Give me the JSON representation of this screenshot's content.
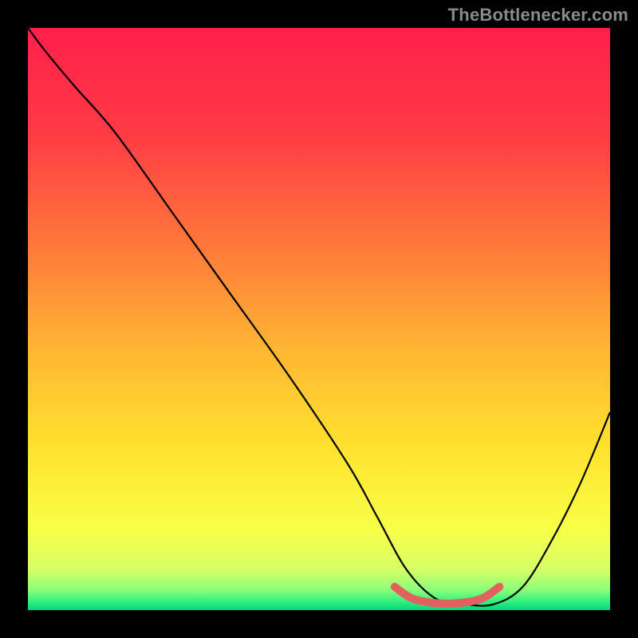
{
  "watermark": "TheBottlenecker.com",
  "colors": {
    "bg": "#000000",
    "curve": "#000000",
    "accent": "#e2615f",
    "gradient_stops": [
      {
        "offset": 0.0,
        "color": "#ff1f4a"
      },
      {
        "offset": 0.18,
        "color": "#ff3a45"
      },
      {
        "offset": 0.38,
        "color": "#ff7a3a"
      },
      {
        "offset": 0.55,
        "color": "#ffb533"
      },
      {
        "offset": 0.72,
        "color": "#ffe22e"
      },
      {
        "offset": 0.86,
        "color": "#f8ff47"
      },
      {
        "offset": 0.93,
        "color": "#d6ff66"
      },
      {
        "offset": 0.965,
        "color": "#8dff7a"
      },
      {
        "offset": 0.985,
        "color": "#33f07e"
      },
      {
        "offset": 1.0,
        "color": "#00d67a"
      }
    ]
  },
  "chart_data": {
    "type": "line",
    "title": "",
    "xlabel": "",
    "ylabel": "",
    "xlim": [
      0,
      100
    ],
    "ylim": [
      0,
      100
    ],
    "grid": false,
    "legend": false,
    "series": [
      {
        "name": "bottleneck-curve",
        "x": [
          0,
          3,
          8,
          15,
          25,
          35,
          45,
          55,
          60,
          65,
          70,
          75,
          80,
          85,
          90,
          95,
          100
        ],
        "y": [
          100,
          96,
          90,
          82,
          68,
          54,
          40,
          25,
          16,
          7,
          2,
          1,
          1,
          4,
          12,
          22,
          34
        ]
      }
    ],
    "accent_segment": {
      "x": [
        63,
        66,
        70,
        74,
        78,
        81
      ],
      "y": [
        4,
        2,
        1.2,
        1.2,
        2,
        4
      ]
    }
  }
}
